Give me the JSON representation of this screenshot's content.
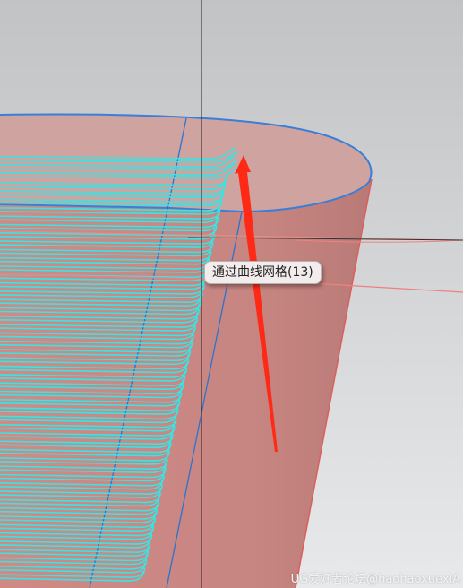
{
  "viewport": {
    "tooltip": {
      "text": "通过曲线网格(13)"
    },
    "watermark": {
      "text": "UG爱好者论坛@haohaoxuexiA"
    },
    "colors": {
      "background_top": "#c2c3c5",
      "background_bottom": "#e8e9eb",
      "surface": "#c98884",
      "surface_top": "#cfa3a0",
      "curve": "#35e6e6",
      "edge": "#3a7ed6",
      "arrow": "#ff2a16",
      "crosshair": "#222222",
      "guide_line": "#f08080"
    }
  }
}
